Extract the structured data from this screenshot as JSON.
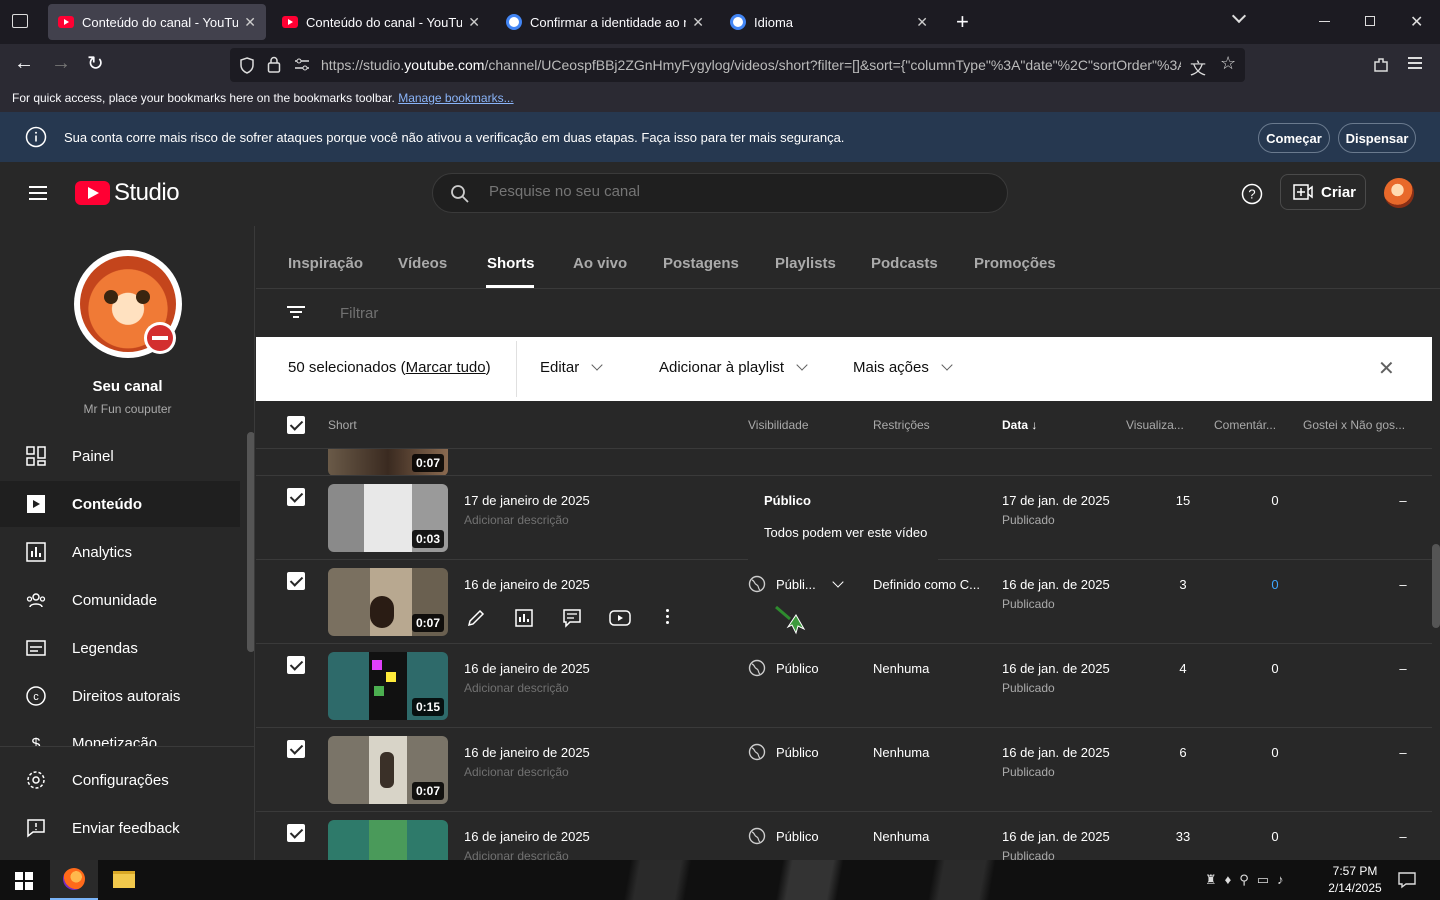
{
  "browser": {
    "tabs": [
      {
        "title": "Conteúdo do canal - YouTube S",
        "favicon": "youtube-icon",
        "active": true
      },
      {
        "title": "Conteúdo do canal - YouTube S",
        "favicon": "youtube-icon",
        "active": false
      },
      {
        "title": "Confirmar a identidade ao realiz",
        "favicon": "google-icon",
        "active": false
      },
      {
        "title": "Idioma",
        "favicon": "google-icon",
        "active": false
      }
    ],
    "url_prefix": "https://studio.",
    "url_domain": "youtube.com",
    "url_rest": "/channel/UCeospfBBj2ZGnHmyFygylog/videos/short?filter=[]&sort={\"columnType\"%3A\"date\"%2C\"sortOrder\"%3A",
    "bookmarks_text": "For quick access, place your bookmarks here on the bookmarks toolbar.",
    "bookmarks_link": "Manage bookmarks..."
  },
  "banner": {
    "message": "Sua conta corre mais risco de sofrer ataques porque você não ativou a verificação em duas etapas. Faça isso para ter mais segurança.",
    "start_label": "Começar",
    "dismiss_label": "Dispensar"
  },
  "header": {
    "logo_text": "Studio",
    "search_placeholder": "Pesquise no seu canal",
    "create_label": "Criar"
  },
  "sidebar": {
    "channel_title": "Seu canal",
    "channel_name": "Mr Fun couputer",
    "items": [
      {
        "label": "Painel",
        "icon": "dashboard-icon"
      },
      {
        "label": "Conteúdo",
        "icon": "content-icon"
      },
      {
        "label": "Analytics",
        "icon": "analytics-icon"
      },
      {
        "label": "Comunidade",
        "icon": "community-icon"
      },
      {
        "label": "Legendas",
        "icon": "subtitles-icon"
      },
      {
        "label": "Direitos autorais",
        "icon": "copyright-icon"
      },
      {
        "label": "Monetização",
        "icon": "monetization-icon"
      }
    ],
    "settings_label": "Configurações",
    "feedback_label": "Enviar feedback"
  },
  "content_tabs": [
    "Inspiração",
    "Vídeos",
    "Shorts",
    "Ao vivo",
    "Postagens",
    "Playlists",
    "Podcasts",
    "Promoções"
  ],
  "active_tab": "Shorts",
  "filter_placeholder": "Filtrar",
  "selection_bar": {
    "selected_text": "50 selecionados (",
    "select_all": "Marcar tudo",
    "close_paren": ")",
    "edit_label": "Editar",
    "add_playlist_label": "Adicionar à playlist",
    "more_actions_label": "Mais ações"
  },
  "table": {
    "headers": [
      "Short",
      "Visibilidade",
      "Restrições",
      "Data",
      "Visualiza...",
      "Comentár...",
      "Gostei x Não gos..."
    ],
    "partial_row_duration": "0:07",
    "rows": [
      {
        "title": "17 de janeiro de 2025",
        "desc": "Adicionar descrição",
        "duration": "0:03",
        "visibility": "Público",
        "restrictions": "",
        "date": "17 de jan. de 2025",
        "date_status": "Publicado",
        "views": "15",
        "comments": "0",
        "likes": "–",
        "tooltip_title": "Público",
        "tooltip_desc": "Todos podem ver este vídeo"
      },
      {
        "title": "16 de janeiro de 2025",
        "desc": "",
        "duration": "0:07",
        "visibility": "Públi...",
        "restrictions": "Definido como C...",
        "date": "16 de jan. de 2025",
        "date_status": "Publicado",
        "views": "3",
        "comments": "0",
        "likes": "–"
      },
      {
        "title": "16 de janeiro de 2025",
        "desc": "Adicionar descrição",
        "duration": "0:15",
        "visibility": "Público",
        "restrictions": "Nenhuma",
        "date": "16 de jan. de 2025",
        "date_status": "Publicado",
        "views": "4",
        "comments": "0",
        "likes": "–"
      },
      {
        "title": "16 de janeiro de 2025",
        "desc": "Adicionar descrição",
        "duration": "0:07",
        "visibility": "Público",
        "restrictions": "Nenhuma",
        "date": "16 de jan. de 2025",
        "date_status": "Publicado",
        "views": "6",
        "comments": "0",
        "likes": "–"
      },
      {
        "title": "16 de janeiro de 2025",
        "desc": "Adicionar descrição",
        "duration": "",
        "visibility": "Público",
        "restrictions": "Nenhuma",
        "date": "16 de jan. de 2025",
        "date_status": "Publicado",
        "views": "33",
        "comments": "0",
        "likes": "–"
      }
    ]
  },
  "taskbar": {
    "time": "7:57 PM",
    "date": "2/14/2025"
  },
  "colors": {
    "accent_blue": "#3ea6ff",
    "youtube_red": "#ff0033",
    "banner_bg": "#263850"
  }
}
